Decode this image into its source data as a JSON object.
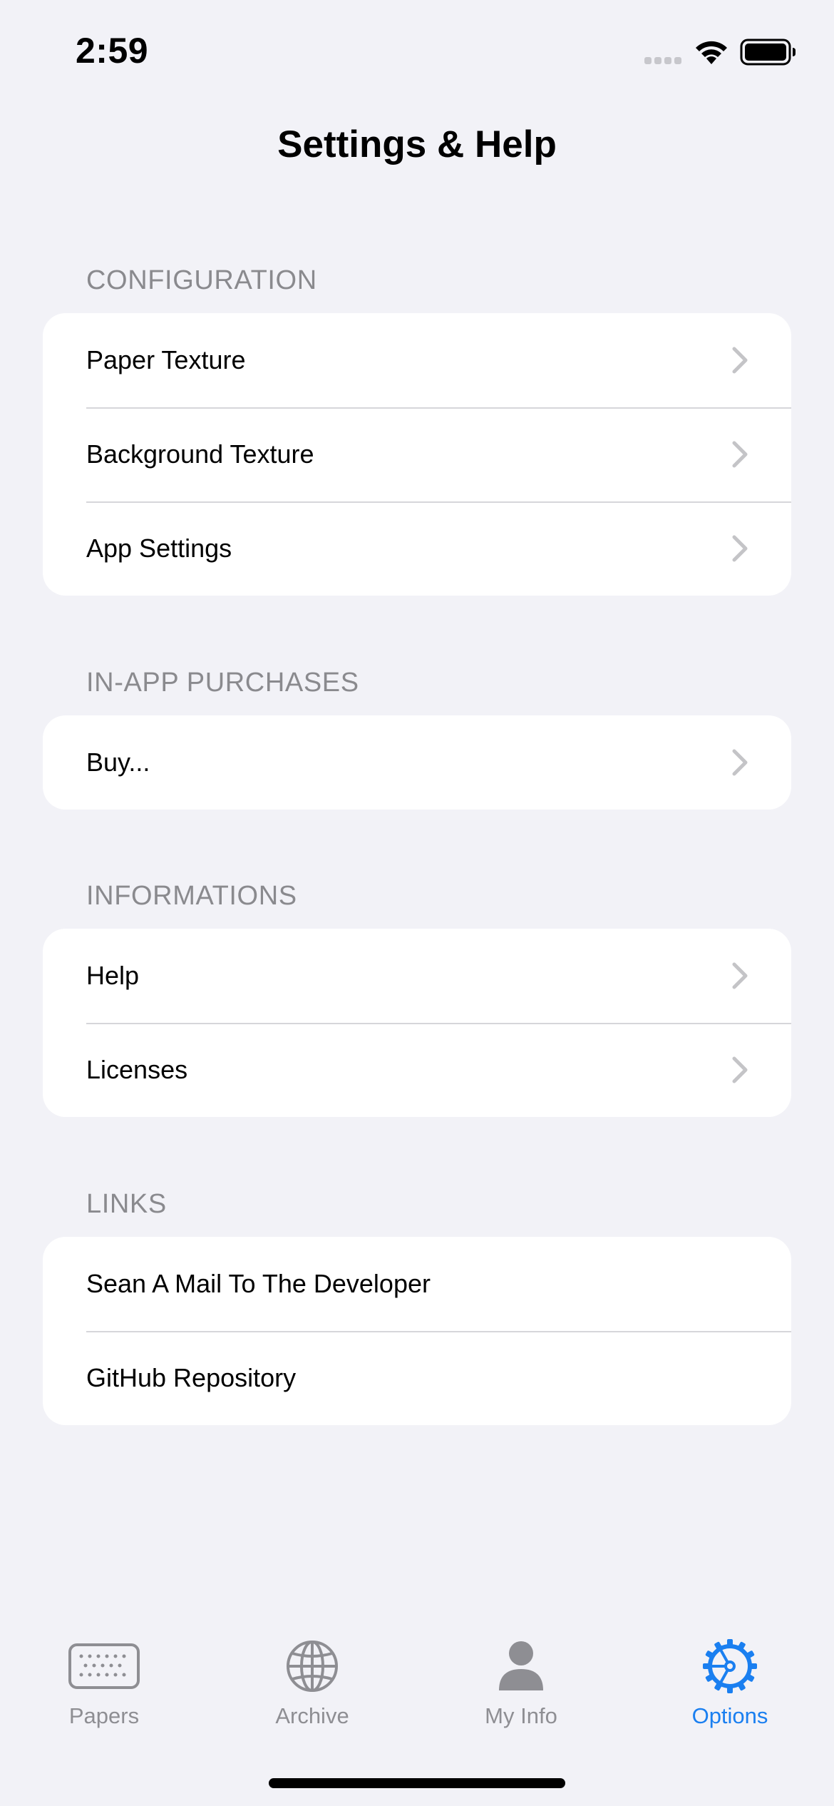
{
  "status_bar": {
    "time": "2:59"
  },
  "nav": {
    "title": "Settings & Help"
  },
  "sections": {
    "configuration": {
      "header": "CONFIGURATION",
      "rows": [
        "Paper Texture",
        "Background Texture",
        "App Settings"
      ]
    },
    "purchases": {
      "header": "IN-APP PURCHASES",
      "rows": [
        "Buy..."
      ]
    },
    "informations": {
      "header": "INFORMATIONS",
      "rows": [
        "Help",
        "Licenses"
      ]
    },
    "links": {
      "header": "LINKS",
      "rows": [
        "Sean A Mail To The Developer",
        "GitHub Repository"
      ]
    }
  },
  "tab_bar": {
    "tabs": [
      {
        "label": "Papers",
        "icon": "keyboard-icon"
      },
      {
        "label": "Archive",
        "icon": "globe-icon"
      },
      {
        "label": "My Info",
        "icon": "person-icon"
      },
      {
        "label": "Options",
        "icon": "gear-icon"
      }
    ],
    "selected": "Options"
  },
  "colors": {
    "background": "#f2f2f7",
    "accent": "#1a7ff0",
    "inactive_tab": "#8e8e93",
    "section_header": "#8a8a8e",
    "chevron": "#c4c4c7"
  }
}
